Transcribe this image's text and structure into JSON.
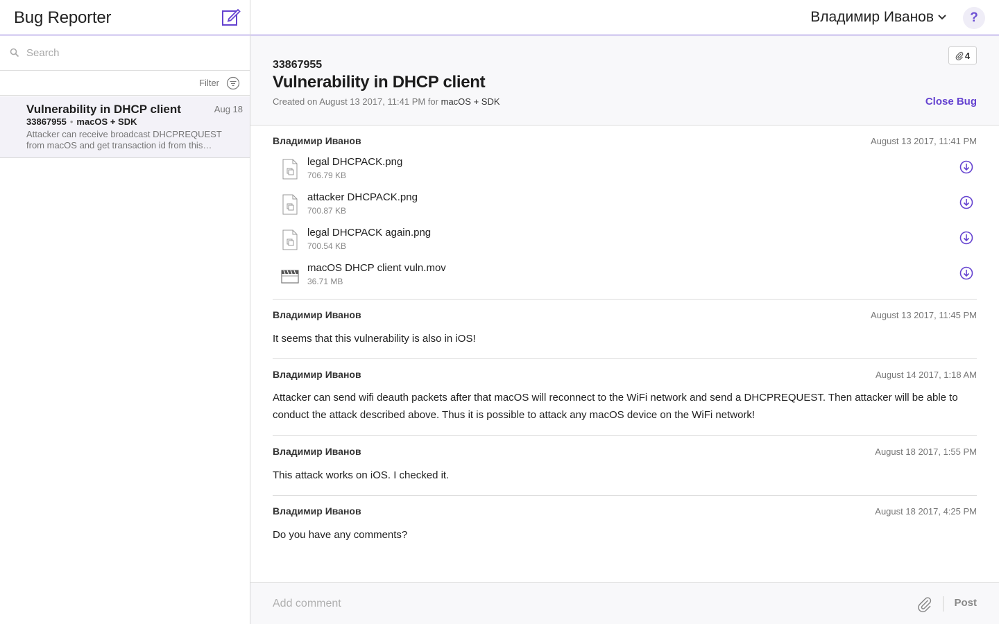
{
  "app": {
    "title": "Bug Reporter"
  },
  "header": {
    "user_name": "Владимир Иванов",
    "help_label": "?"
  },
  "sidebar": {
    "search_placeholder": "Search",
    "filter_label": "Filter",
    "bugs": [
      {
        "title": "Vulnerability in DHCP client",
        "date": "Aug 18",
        "id": "33867955",
        "platform": "macOS + SDK",
        "summary": "Attacker can receive broadcast DHCPREQUEST from macOS and get transaction id from this…"
      }
    ]
  },
  "bug": {
    "id": "33867955",
    "title": "Vulnerability in DHCP client",
    "created_prefix": "Created on August 13 2017, 11:41 PM for",
    "platform": "macOS + SDK",
    "attachment_count": "4",
    "close_label": "Close Bug"
  },
  "thread": [
    {
      "author": "Владимир Иванов",
      "date": "August 13 2017, 11:41 PM",
      "attachments": [
        {
          "name": "legal DHCPACK.png",
          "size": "706.79 KB",
          "icon": "image-file-icon"
        },
        {
          "name": "attacker DHCPACK.png",
          "size": "700.87 KB",
          "icon": "image-file-icon"
        },
        {
          "name": "legal DHCPACK again.png",
          "size": "700.54 KB",
          "icon": "image-file-icon"
        },
        {
          "name": "macOS DHCP client vuln.mov",
          "size": "36.71 MB",
          "icon": "video-file-icon"
        }
      ]
    },
    {
      "author": "Владимир Иванов",
      "date": "August 13 2017, 11:45 PM",
      "text": "It seems that this vulnerability is also in iOS!"
    },
    {
      "author": "Владимир Иванов",
      "date": "August 14 2017, 1:18 AM",
      "text": "Attacker can send wifi deauth packets after that macOS will reconnect to the WiFi network and send a DHCPREQUEST. Then attacker will be able to conduct the attack described above. Thus it is possible to attack any macOS device on the WiFi network!"
    },
    {
      "author": "Владимир Иванов",
      "date": "August 18 2017, 1:55 PM",
      "text": "This attack works on iOS. I checked it."
    },
    {
      "author": "Владимир Иванов",
      "date": "August 18 2017, 4:25 PM",
      "text": "Do you have any comments?"
    }
  ],
  "composer": {
    "placeholder": "Add comment",
    "post_label": "Post"
  },
  "colors": {
    "accent": "#6543d0",
    "header_border": "#7a5fd6",
    "selected_row": "#f3f2f8"
  }
}
